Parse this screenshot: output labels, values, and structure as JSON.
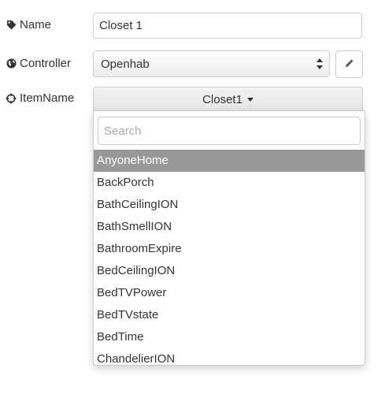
{
  "form": {
    "name": {
      "label": "Name",
      "icon": "tag-icon",
      "value": "Closet 1"
    },
    "controller": {
      "label": "Controller",
      "icon": "globe-icon",
      "selected": "Openhab",
      "edit_icon": "pencil-icon"
    },
    "item_name": {
      "label": "ItemName",
      "icon": "crosshairs-icon",
      "selected": "Closet1"
    }
  },
  "dropdown": {
    "search_placeholder": "Search",
    "options": [
      "AnyoneHome",
      "BackPorch",
      "BathCeilingION",
      "BathSmellION",
      "BathroomExpire",
      "BedCeilingION",
      "BedTVPower",
      "BedTVstate",
      "BedTime",
      "ChandelierION"
    ],
    "active_option": "AnyoneHome"
  },
  "colors": {
    "active_bg": "#999999",
    "border": "#cccccc",
    "text": "#333333"
  }
}
